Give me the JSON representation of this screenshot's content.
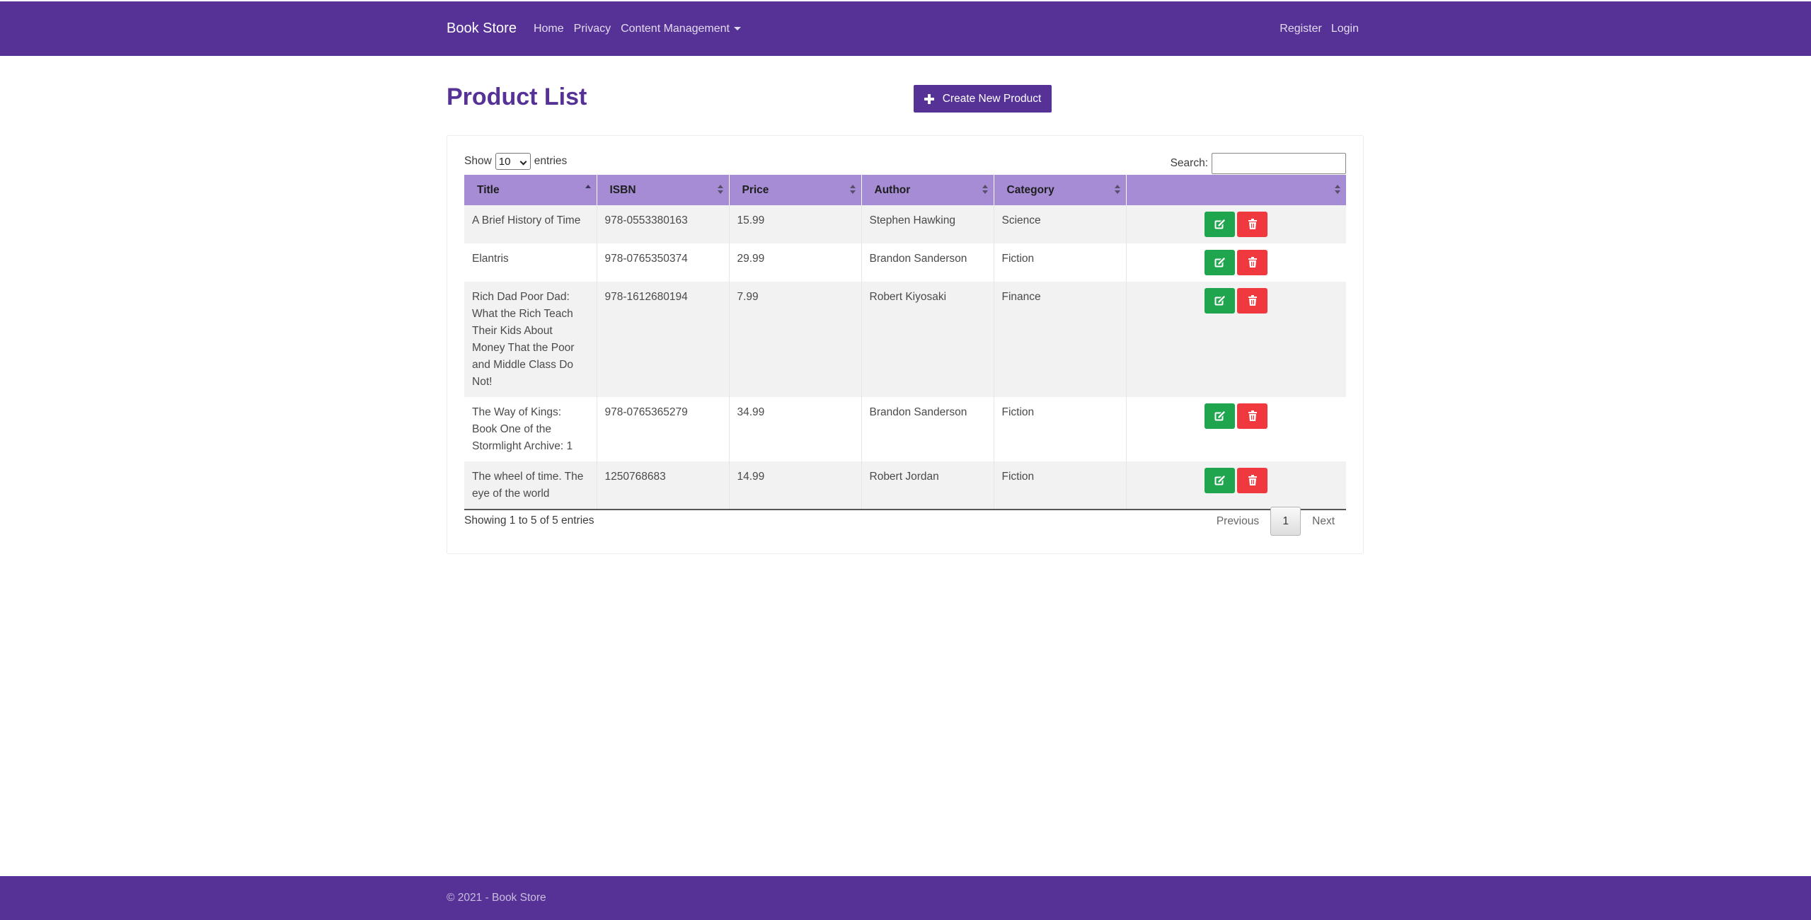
{
  "navbar": {
    "brand": "Book Store",
    "links": [
      "Home",
      "Privacy",
      "Content Management"
    ],
    "register": "Register",
    "login": "Login"
  },
  "header": {
    "title": "Product List",
    "create_label": "Create New Product"
  },
  "table_controls": {
    "show_label": "Show",
    "length_value": "10",
    "entries_label": "entries",
    "search_label": "Search:",
    "search_value": ""
  },
  "table": {
    "columns": [
      "Title",
      "ISBN",
      "Price",
      "Author",
      "Category",
      ""
    ],
    "rows": [
      {
        "title": "A Brief History of Time",
        "isbn": "978-0553380163",
        "price": "15.99",
        "author": "Stephen Hawking",
        "category": "Science"
      },
      {
        "title": "Elantris",
        "isbn": "978-0765350374",
        "price": "29.99",
        "author": "Brandon Sanderson",
        "category": "Fiction"
      },
      {
        "title": "Rich Dad Poor Dad: What the Rich Teach Their Kids About Money That the Poor and Middle Class Do Not!",
        "isbn": "978-1612680194",
        "price": "7.99",
        "author": "Robert Kiyosaki",
        "category": "Finance"
      },
      {
        "title": "The Way of Kings: Book One of the Stormlight Archive: 1",
        "isbn": "978-0765365279",
        "price": "34.99",
        "author": "Brandon Sanderson",
        "category": "Fiction"
      },
      {
        "title": "The wheel of time. The eye of the world",
        "isbn": "1250768683",
        "price": "14.99",
        "author": "Robert Jordan",
        "category": "Fiction"
      }
    ]
  },
  "pagination": {
    "info": "Showing 1 to 5 of 5 entries",
    "previous": "Previous",
    "current_page": "1",
    "next": "Next"
  },
  "footer": {
    "text": "© 2021 - Book Store"
  },
  "colors": {
    "brand_purple": "#563297",
    "header_lavender": "#a68cd4",
    "edit_green": "#1ea54e",
    "delete_red": "#f0393e"
  },
  "icons": {
    "create": "plus-icon",
    "edit": "edit-icon",
    "delete": "trash-icon"
  }
}
